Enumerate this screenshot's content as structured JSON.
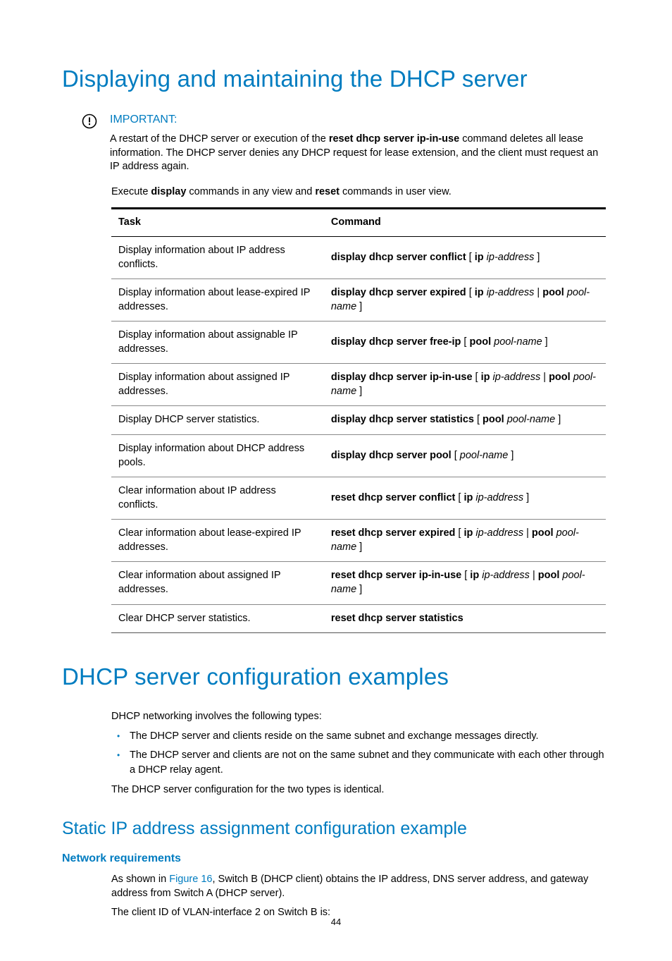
{
  "heading1": "Displaying and maintaining the DHCP server",
  "admonition": {
    "title": "IMPORTANT:",
    "text_pre": "A restart of the DHCP server or execution of the ",
    "text_bold": "reset dhcp server ip-in-use",
    "text_post": " command deletes all lease information. The DHCP server denies any DHCP request for lease extension, and the client must request an IP address again."
  },
  "intro": {
    "pre": "Execute ",
    "b1": "display",
    "mid": " commands in any view and ",
    "b2": "reset",
    "post": " commands in user view."
  },
  "table": {
    "head_task": "Task",
    "head_cmd": "Command",
    "rows": [
      {
        "task": "Display information about IP address conflicts.",
        "cmd": [
          {
            "t": "display dhcp server conflict",
            "s": "b"
          },
          {
            "t": " [ ",
            "s": ""
          },
          {
            "t": "ip",
            "s": "b"
          },
          {
            "t": " ",
            "s": ""
          },
          {
            "t": "ip-address",
            "s": "i"
          },
          {
            "t": " ]",
            "s": ""
          }
        ]
      },
      {
        "task": "Display information about lease-expired IP addresses.",
        "cmd": [
          {
            "t": "display dhcp server expired",
            "s": "b"
          },
          {
            "t": " [ ",
            "s": ""
          },
          {
            "t": "ip",
            "s": "b"
          },
          {
            "t": " ",
            "s": ""
          },
          {
            "t": "ip-address",
            "s": "i"
          },
          {
            "t": " | ",
            "s": ""
          },
          {
            "t": "pool",
            "s": "b"
          },
          {
            "t": " ",
            "s": ""
          },
          {
            "t": "pool-name",
            "s": "i"
          },
          {
            "t": " ]",
            "s": ""
          }
        ]
      },
      {
        "task": "Display information about assignable IP addresses.",
        "cmd": [
          {
            "t": "display dhcp server free-ip",
            "s": "b"
          },
          {
            "t": " [ ",
            "s": ""
          },
          {
            "t": "pool",
            "s": "b"
          },
          {
            "t": " ",
            "s": ""
          },
          {
            "t": "pool-name",
            "s": "i"
          },
          {
            "t": " ]",
            "s": ""
          }
        ]
      },
      {
        "task": "Display information about assigned IP addresses.",
        "cmd": [
          {
            "t": "display dhcp server ip-in-use",
            "s": "b"
          },
          {
            "t": " [ ",
            "s": ""
          },
          {
            "t": "ip",
            "s": "b"
          },
          {
            "t": " ",
            "s": ""
          },
          {
            "t": "ip-address",
            "s": "i"
          },
          {
            "t": " | ",
            "s": ""
          },
          {
            "t": "pool",
            "s": "b"
          },
          {
            "t": " ",
            "s": ""
          },
          {
            "t": "pool-name",
            "s": "i"
          },
          {
            "t": " ]",
            "s": ""
          }
        ]
      },
      {
        "task": "Display DHCP server statistics.",
        "cmd": [
          {
            "t": "display dhcp server statistics",
            "s": "b"
          },
          {
            "t": " [ ",
            "s": ""
          },
          {
            "t": "pool",
            "s": "b"
          },
          {
            "t": " ",
            "s": ""
          },
          {
            "t": "pool-name",
            "s": "i"
          },
          {
            "t": " ]",
            "s": ""
          }
        ]
      },
      {
        "task": "Display information about DHCP address pools.",
        "cmd": [
          {
            "t": "display dhcp server pool",
            "s": "b"
          },
          {
            "t": " [ ",
            "s": ""
          },
          {
            "t": "pool-name",
            "s": "i"
          },
          {
            "t": " ]",
            "s": ""
          }
        ]
      },
      {
        "task": "Clear information about IP address conflicts.",
        "cmd": [
          {
            "t": "reset dhcp server conflict",
            "s": "b"
          },
          {
            "t": " [ ",
            "s": ""
          },
          {
            "t": "ip",
            "s": "b"
          },
          {
            "t": " ",
            "s": ""
          },
          {
            "t": "ip-address",
            "s": "i"
          },
          {
            "t": " ]",
            "s": ""
          }
        ]
      },
      {
        "task": "Clear information about lease-expired IP addresses.",
        "cmd": [
          {
            "t": "reset dhcp server expired",
            "s": "b"
          },
          {
            "t": " [ ",
            "s": ""
          },
          {
            "t": "ip",
            "s": "b"
          },
          {
            "t": " ",
            "s": ""
          },
          {
            "t": "ip-address",
            "s": "i"
          },
          {
            "t": " | ",
            "s": ""
          },
          {
            "t": "pool",
            "s": "b"
          },
          {
            "t": " ",
            "s": ""
          },
          {
            "t": "pool-name",
            "s": "i"
          },
          {
            "t": " ]",
            "s": ""
          }
        ]
      },
      {
        "task": "Clear information about assigned IP addresses.",
        "cmd": [
          {
            "t": "reset dhcp server ip-in-use",
            "s": "b"
          },
          {
            "t": " [ ",
            "s": ""
          },
          {
            "t": "ip",
            "s": "b"
          },
          {
            "t": " ",
            "s": ""
          },
          {
            "t": "ip-address",
            "s": "i"
          },
          {
            "t": " | ",
            "s": ""
          },
          {
            "t": "pool",
            "s": "b"
          },
          {
            "t": " ",
            "s": ""
          },
          {
            "t": "pool-name",
            "s": "i"
          },
          {
            "t": " ]",
            "s": ""
          }
        ]
      },
      {
        "task": "Clear DHCP server statistics.",
        "cmd": [
          {
            "t": "reset dhcp server statistics",
            "s": "b"
          }
        ]
      }
    ]
  },
  "heading2": "DHCP server configuration examples",
  "section2": {
    "intro": "DHCP networking involves the following types:",
    "bullets": [
      "The DHCP server and clients reside on the same subnet and exchange messages directly.",
      "The DHCP server and clients are not on the same subnet and they communicate with each other through a DHCP relay agent."
    ],
    "closing": "The DHCP server configuration for the two types is identical."
  },
  "heading3": "Static IP address assignment configuration example",
  "heading4": "Network requirements",
  "netreq": {
    "pre": "As shown in ",
    "link": "Figure 16",
    "post": ", Switch B (DHCP client) obtains the IP address, DNS server address, and gateway address from Switch A (DHCP server).",
    "line2": "The client ID of VLAN-interface 2 on Switch B is:"
  },
  "pagenum": "44"
}
